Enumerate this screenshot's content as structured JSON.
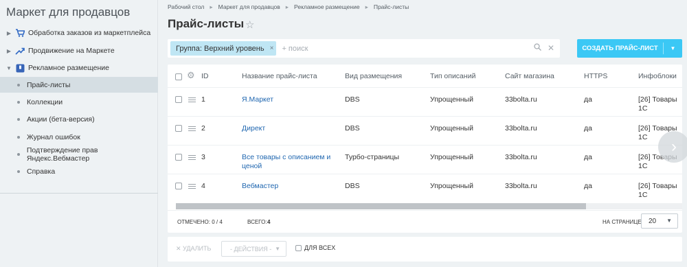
{
  "sidebar": {
    "title": "Маркет для продавцов",
    "items": [
      {
        "label": "Обработка заказов из маркетплейса",
        "arrow": "▶"
      },
      {
        "label": "Продвижение на Маркете",
        "arrow": "▶"
      },
      {
        "label": "Рекламное размещение",
        "arrow": "▼"
      }
    ],
    "subitems": [
      {
        "label": "Прайс-листы"
      },
      {
        "label": "Коллекции"
      },
      {
        "label": "Акции (бета-версия)"
      },
      {
        "label": "Журнал ошибок"
      },
      {
        "label": "Подтверждение прав Яндекс.Вебмастер"
      },
      {
        "label": "Справка"
      }
    ]
  },
  "breadcrumb": [
    "Рабочий стол",
    "Маркет для продавцов",
    "Рекламное размещение",
    "Прайс-листы"
  ],
  "breadcrumb_sep": "▸",
  "page_title": "Прайс-листы",
  "filter": {
    "chip": "Группа: Верхний уровень",
    "chip_remove": "×",
    "placeholder": "+ поиск",
    "search_icon": "⚲",
    "clear_icon": "✕"
  },
  "create_button": {
    "label": "СОЗДАТЬ ПРАЙС-ЛИСТ",
    "caret": "▼"
  },
  "table": {
    "columns": [
      "ID",
      "Название прайс-листа",
      "Вид размещения",
      "Тип описаний",
      "Сайт магазина",
      "HTTPS",
      "Инфоблоки"
    ],
    "rows": [
      {
        "id": "1",
        "name": "Я.Маркет",
        "name2": "",
        "placement": "DBS",
        "desc_type": "Упрощенный",
        "site": "33bolta.ru",
        "https": "да",
        "iblocks": "[26] Товары",
        "iblocks2": "1С"
      },
      {
        "id": "2",
        "name": "Директ",
        "name2": "",
        "placement": "DBS",
        "desc_type": "Упрощенный",
        "site": "33bolta.ru",
        "https": "да",
        "iblocks": "[26] Товары",
        "iblocks2": "1С"
      },
      {
        "id": "3",
        "name": "Все товары с описанием и",
        "name2": "ценой",
        "placement": "Турбо-страницы",
        "desc_type": "Упрощенный",
        "site": "33bolta.ru",
        "https": "да",
        "iblocks": "[26] Товары",
        "iblocks2": "1С"
      },
      {
        "id": "4",
        "name": "Вебмастер",
        "name2": "",
        "placement": "DBS",
        "desc_type": "Упрощенный",
        "site": "33bolta.ru",
        "https": "да",
        "iblocks": "[26] Товары",
        "iblocks2": "1С"
      }
    ],
    "scroll_position": 0.81
  },
  "footer": {
    "selected": "ОТМЕЧЕНО: 0 / 4",
    "total_label": "ВСЕГО:",
    "total_value": "4",
    "per_page_label": "НА СТРАНИЦЕ:",
    "per_page_value": "20"
  },
  "actions": {
    "delete": "✕ УДАЛИТЬ",
    "actions_select": "- ДЕЙСТВИЯ -",
    "for_all": "ДЛЯ ВСЕХ"
  },
  "colors": {
    "accent": "#3bc8f5",
    "chip": "#bfe6f4",
    "link": "#2067b0"
  }
}
